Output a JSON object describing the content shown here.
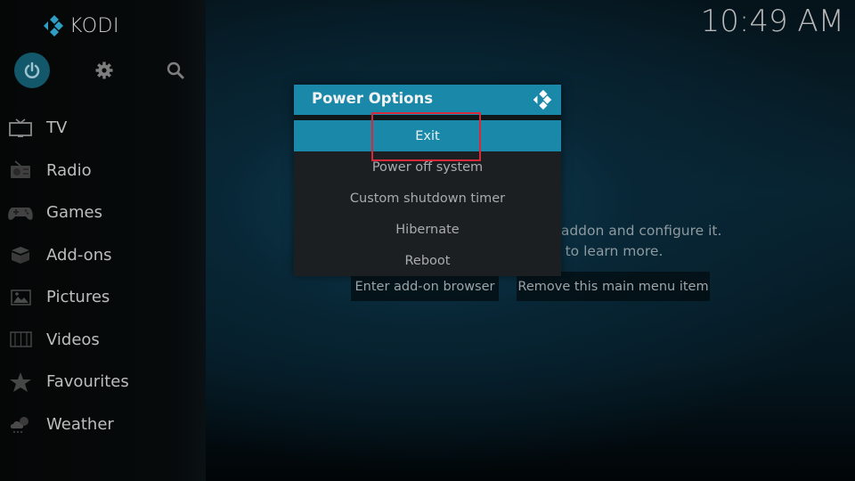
{
  "app": {
    "name": "KODI",
    "clock": "10:49 AM",
    "accent_color": "#1a88a8"
  },
  "topbar": {
    "icons": [
      {
        "name": "power-icon",
        "label": "Power",
        "active": true
      },
      {
        "name": "gear-icon",
        "label": "Settings",
        "active": false
      },
      {
        "name": "search-icon",
        "label": "Search",
        "active": false
      }
    ]
  },
  "sidebar": {
    "items": [
      {
        "label": "TV",
        "icon": "tv-icon"
      },
      {
        "label": "Radio",
        "icon": "radio-icon"
      },
      {
        "label": "Games",
        "icon": "gamepad-icon"
      },
      {
        "label": "Add-ons",
        "icon": "box-icon"
      },
      {
        "label": "Pictures",
        "icon": "picture-icon"
      },
      {
        "label": "Videos",
        "icon": "film-icon"
      },
      {
        "label": "Favourites",
        "icon": "star-icon"
      },
      {
        "label": "Weather",
        "icon": "weather-icon"
      }
    ]
  },
  "main": {
    "message_line1": "You did not choose a PVR client addon and configure it.",
    "message_line2": "Visit kodi.wiki/view/PVR to learn more.",
    "buttons": {
      "addon_browser": "Enter add-on browser",
      "remove_item": "Remove this main menu item"
    }
  },
  "dialog": {
    "title": "Power Options",
    "options": [
      {
        "label": "Exit",
        "selected": true
      },
      {
        "label": "Power off system",
        "selected": false
      },
      {
        "label": "Custom shutdown timer",
        "selected": false
      },
      {
        "label": "Hibernate",
        "selected": false
      },
      {
        "label": "Reboot",
        "selected": false
      }
    ],
    "highlight_color": "#d8283a"
  }
}
